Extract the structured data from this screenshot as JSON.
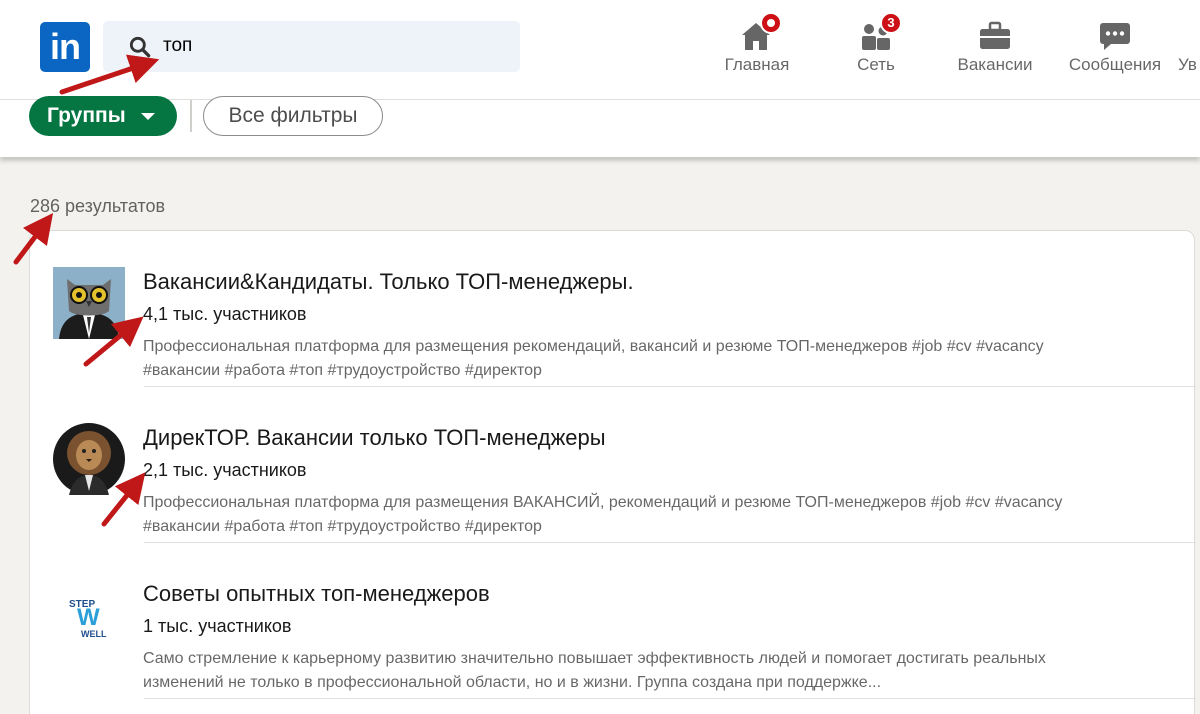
{
  "nav": {
    "logo_text": "in",
    "search": {
      "value": "топ"
    },
    "items": [
      {
        "label": "Главная",
        "icon": "home-icon"
      },
      {
        "label": "Сеть",
        "icon": "network-icon",
        "badge": "3"
      },
      {
        "label": "Вакансии",
        "icon": "briefcase-icon"
      },
      {
        "label": "Сообщения",
        "icon": "messaging-icon"
      },
      {
        "label": "Ув",
        "icon": "bell-icon"
      }
    ]
  },
  "filters": {
    "groups_label": "Группы",
    "all_filters_label": "Все фильтры"
  },
  "results": {
    "count_text": "286 результатов",
    "items": [
      {
        "title": "Вакансии&Кандидаты. Только ТОП-менеджеры.",
        "members": "4,1 тыс. участников",
        "description": "Профессиональная платформа для размещения рекомендаций, вакансий и резюме ТОП-менеджеров #job #cv #vacancy #вакансии #работа #топ #трудоустройство #директор"
      },
      {
        "title": "ДирекТОР. Вакансии только ТОП-менеджеры",
        "members": "2,1 тыс. участников",
        "description": "Профессиональная платформа для размещения ВАКАНСИЙ, рекомендаций и резюме ТОП-менеджеров #job #cv #vacancy #вакансии #работа #топ #трудоустройство #директор"
      },
      {
        "title": "Советы опытных топ-менеджеров",
        "members": "1 тыс. участников",
        "description": "Само стремление к карьерному развитию значительно повышает эффективность людей и помогает достигать реальных изменений не только в профессиональной области, но и в жизни. Группа создана при поддержке...",
        "logo_text_top": "STEP",
        "logo_text_mid": "W",
        "logo_text_bottom": "WELL"
      }
    ]
  },
  "colors": {
    "linkedin_blue": "#0a66c2",
    "groups_green": "#057642",
    "badge_red": "#cc1016",
    "annotation_red": "#c01818"
  }
}
